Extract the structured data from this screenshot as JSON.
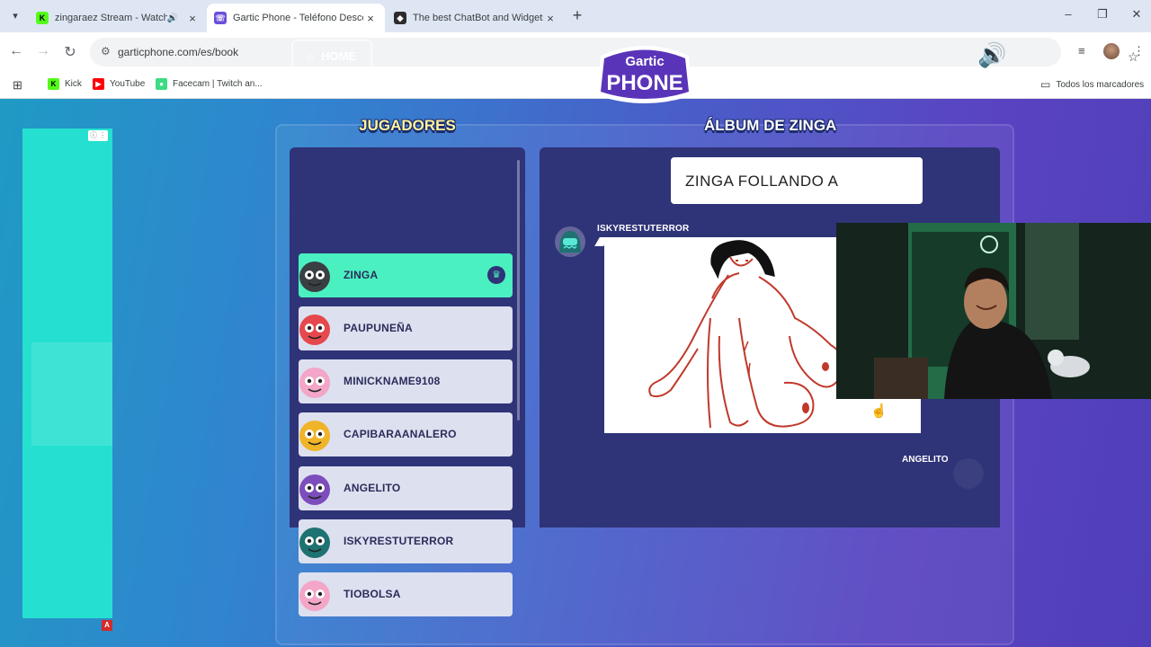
{
  "browser": {
    "tabs": [
      {
        "title": "zingaraez Stream - Watch L",
        "favicon": "kick-icon",
        "color": "#53fc18",
        "audio": true
      },
      {
        "title": "Gartic Phone - Teléfono Descon",
        "favicon": "gartic-icon",
        "color": "#6b4fd8",
        "active": true
      },
      {
        "title": "The best ChatBot and Widgets f",
        "favicon": "bot-icon",
        "color": "#2c2c2c"
      }
    ],
    "url": "garticphone.com/es/book",
    "bookmarks": [
      {
        "label": "Kick",
        "favicon": "kick-icon",
        "color": "#53fc18"
      },
      {
        "label": "YouTube",
        "favicon": "youtube-icon",
        "color": "#ff0000"
      },
      {
        "label": "Facecam | Twitch an...",
        "favicon": "android-icon",
        "color": "#3ddc84"
      }
    ],
    "all_bookmarks": "Todos los marcadores"
  },
  "game": {
    "home_label": "HOME",
    "logo_line1": "Gartic",
    "logo_line2": "PHONE",
    "players_title": "JUGADORES",
    "album_title": "ÁLBUM DE ZINGA",
    "players": [
      {
        "name": "ZINGA",
        "selected": true,
        "host": true,
        "color": "#3a3f44"
      },
      {
        "name": "PAUPUNEÑA",
        "color": "#e5484d"
      },
      {
        "name": "MINICKNAME9108",
        "color": "#f3a6c8"
      },
      {
        "name": "CAPIBARAANALERO",
        "color": "#f0b429"
      },
      {
        "name": "ANGELITO",
        "color": "#7c4dbb"
      },
      {
        "name": "ISKYRESTUTERROR",
        "color": "#1e7272"
      },
      {
        "name": "TIOBOLSA",
        "color": "#f3a6c8"
      }
    ],
    "album": {
      "prompt_text": "ZINGA FOLLANDO A",
      "drawing_author": "ISKYRESTUTERROR",
      "next_author": "ANGELITO"
    }
  },
  "colors": {
    "selected_player": "#4bf0c1",
    "list_bg": "#2f3377",
    "ad_bg": "#25e0d0"
  }
}
